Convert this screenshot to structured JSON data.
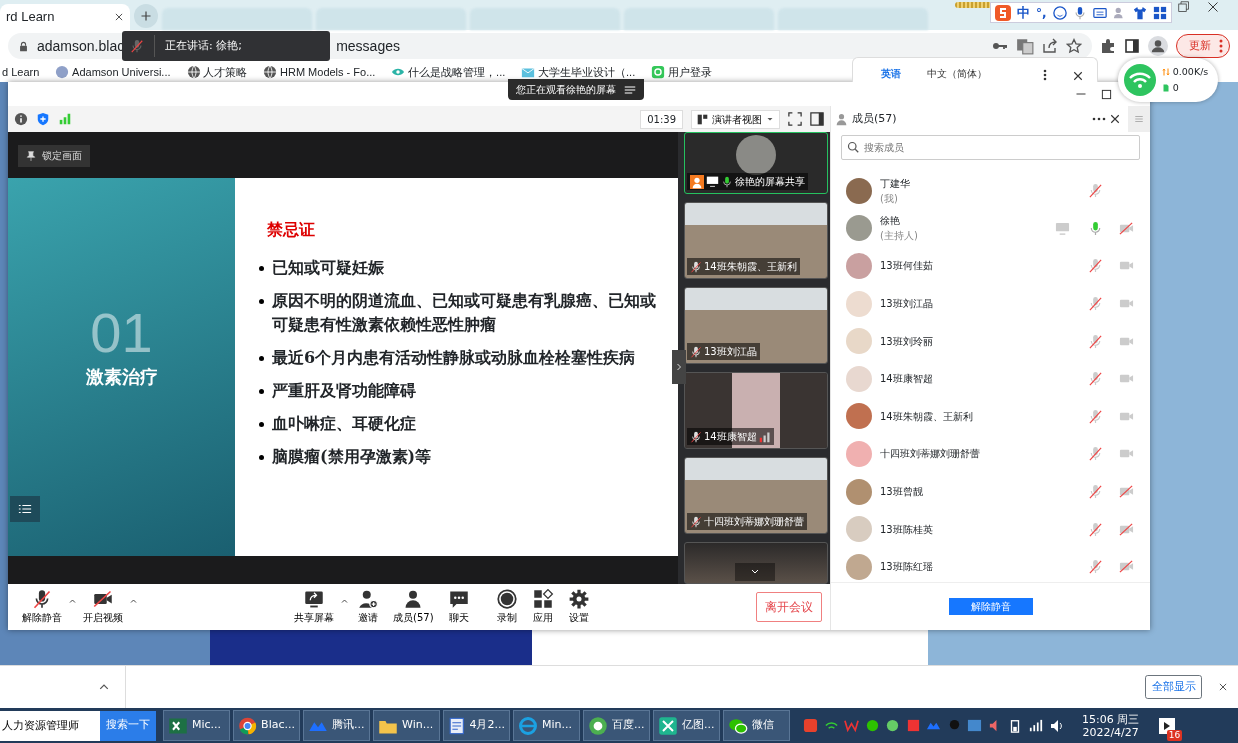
{
  "browser": {
    "active_tab": {
      "label": "rd Learn",
      "selected": true
    },
    "address_bar": {
      "url_start": "adamson.blac",
      "url_end": "messages"
    },
    "update_button": "更新",
    "bookmarks": [
      {
        "label": "d Learn",
        "kind": "plain"
      },
      {
        "label": "Adamson Universi...",
        "kind": "seal"
      },
      {
        "label": "人才策略",
        "kind": "globe"
      },
      {
        "label": "HRM Models - Fo...",
        "kind": "globe"
      },
      {
        "label": "什么是战略管理，...",
        "kind": "eye"
      },
      {
        "label": "大学生毕业设计（...",
        "kind": "mail"
      },
      {
        "label": "用户登录",
        "kind": "app"
      }
    ],
    "translate_popup": {
      "options": [
        {
          "label": "英语",
          "selected": true
        },
        {
          "label": "中文（简体）",
          "selected": false
        }
      ]
    },
    "download_bar": {
      "button": "全部显示"
    }
  },
  "speaking_tooltip": {
    "text": "正在讲话: 徐艳;"
  },
  "ime_bar": {
    "mode": "中",
    "punct": "°,"
  },
  "network_widget": {
    "speed": "0.00K/s",
    "count": "0"
  },
  "meeting": {
    "banner": "您正在观看徐艳的屏幕",
    "timer": "01:39",
    "view_mode": "演讲者视图",
    "lock_button": "锁定画面",
    "slide": {
      "number": "01",
      "section": "激素治疗",
      "title": "禁忌证",
      "bullets": [
        "已知或可疑妊娠",
        "原因不明的阴道流血、已知或可疑患有乳腺癌、已知或可疑患有性激素依赖性恶性肿瘤",
        "最近6个月内患有活动性静脉或动脉血栓栓塞性疾病",
        "严重肝及肾功能障碍",
        "血卟啉症、耳硬化症",
        "脑膜瘤(禁用孕激素)等"
      ]
    },
    "video_tiles": [
      {
        "kind": "share",
        "name": "徐艳的屏幕共享",
        "mic_on": true,
        "active": true,
        "weak_signal": false
      },
      {
        "kind": "camera",
        "name": "14班朱朝霞、王新利",
        "mic_on": false,
        "active": false,
        "weak_signal": false
      },
      {
        "kind": "camera",
        "name": "13班刘江晶",
        "mic_on": false,
        "active": false,
        "weak_signal": false
      },
      {
        "kind": "portrait",
        "name": "14班康智超",
        "mic_on": false,
        "active": false,
        "weak_signal": true
      },
      {
        "kind": "camera",
        "name": "十四班刘蒂娜刘珊舒蕾",
        "mic_on": false,
        "active": false,
        "weak_signal": false
      },
      {
        "kind": "cut"
      }
    ],
    "toolbar": [
      {
        "label": "解除静音",
        "kind": "mic_off",
        "caret": true
      },
      {
        "label": "开启视频",
        "kind": "cam_off",
        "caret": true
      },
      {
        "label": "共享屏幕",
        "kind": "share",
        "caret": true
      },
      {
        "label": "邀请",
        "kind": "invite",
        "caret": false
      },
      {
        "label": "成员(57)",
        "kind": "members",
        "caret": false
      },
      {
        "label": "聊天",
        "kind": "chat",
        "caret": false
      },
      {
        "label": "录制",
        "kind": "record",
        "caret": false
      },
      {
        "label": "应用",
        "kind": "apps",
        "caret": false
      },
      {
        "label": "设置",
        "kind": "settings",
        "caret": false
      }
    ],
    "leave_button": "离开会议",
    "members": {
      "title": "成员(57)",
      "search": {
        "placeholder": "搜索成员"
      },
      "list": [
        {
          "name": "丁建华",
          "role": "(我)",
          "mic_on": false,
          "sharing": false
        },
        {
          "name": "徐艳",
          "role": "(主持人)",
          "mic_on": true,
          "camera_on": false,
          "sharing": true
        },
        {
          "name": "13班何佳茹",
          "mic_on": false,
          "camera_on": true,
          "sharing": false
        },
        {
          "name": "13班刘江晶",
          "mic_on": false,
          "camera_on": true,
          "sharing": false
        },
        {
          "name": "13班刘玲丽",
          "mic_on": false,
          "camera_on": true,
          "sharing": false
        },
        {
          "name": "14班康智超",
          "mic_on": false,
          "camera_on": true,
          "sharing": false
        },
        {
          "name": "14班朱朝霞、王新利",
          "mic_on": false,
          "camera_on": true,
          "sharing": false
        },
        {
          "name": "十四班刘蒂娜刘珊舒蕾",
          "mic_on": false,
          "camera_on": true,
          "sharing": false
        },
        {
          "name": "13班曾靓",
          "mic_on": false,
          "camera_on": false,
          "sharing": false
        },
        {
          "name": "13班陈桂英",
          "mic_on": false,
          "camera_on": false,
          "sharing": false
        },
        {
          "name": "13班陈红瑶",
          "mic_on": false,
          "camera_on": false,
          "sharing": false
        }
      ],
      "unmute_button": "解除静音"
    }
  },
  "taskbar": {
    "search": {
      "value": "人力资源管理师"
    },
    "search_button": "搜索一下",
    "tasks": [
      {
        "label": "Mic...",
        "kind": "excel"
      },
      {
        "label": "Blac...",
        "kind": "chrome"
      },
      {
        "label": "腾讯...",
        "kind": "meeting"
      },
      {
        "label": "Win...",
        "kind": "folder"
      },
      {
        "label": "4月2...",
        "kind": "doc"
      },
      {
        "label": "Min...",
        "kind": "ie"
      },
      {
        "label": "百度...",
        "kind": "baidu"
      },
      {
        "label": "亿图...",
        "kind": "edraw"
      },
      {
        "label": "微信",
        "kind": "wechat"
      }
    ],
    "time": "15:06 周三",
    "date": "2022/4/27",
    "notifications": "16"
  }
}
